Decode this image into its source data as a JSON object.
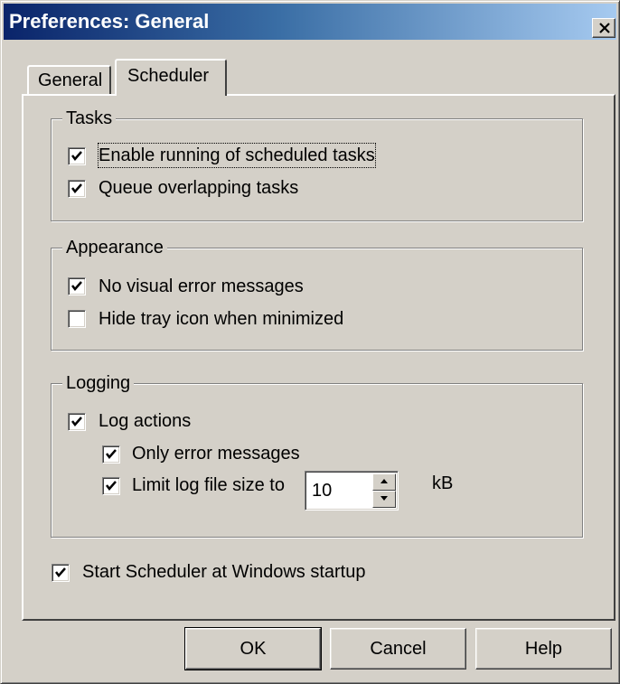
{
  "window": {
    "title": "Preferences: General"
  },
  "tabs": [
    {
      "label": "General",
      "selected": false
    },
    {
      "label": "Scheduler",
      "selected": true
    }
  ],
  "groups": {
    "tasks": {
      "title": "Tasks",
      "items": [
        {
          "label": "Enable running of scheduled tasks",
          "checked": true,
          "focused": true
        },
        {
          "label": "Queue overlapping tasks",
          "checked": true
        }
      ]
    },
    "appearance": {
      "title": "Appearance",
      "items": [
        {
          "label": "No visual error messages",
          "checked": true
        },
        {
          "label": "Hide tray icon when minimized",
          "checked": false
        }
      ]
    },
    "logging": {
      "title": "Logging",
      "log_actions": {
        "label": "Log actions",
        "checked": true
      },
      "only_errors": {
        "label": "Only error messages",
        "checked": true
      },
      "limit_size": {
        "label": "Limit log file size to",
        "checked": true
      },
      "size_value": "10",
      "size_unit": "kB"
    }
  },
  "startup": {
    "label": "Start Scheduler at Windows startup",
    "checked": true
  },
  "buttons": {
    "ok": "OK",
    "cancel": "Cancel",
    "help": "Help"
  },
  "colors": {
    "face": "#d4d0c8",
    "title_start": "#0a246a",
    "title_end": "#a6caf0"
  },
  "icons": {
    "close": "close-icon",
    "check": "checkmark-icon",
    "spin_up": "arrow-up-icon",
    "spin_down": "arrow-down-icon"
  }
}
